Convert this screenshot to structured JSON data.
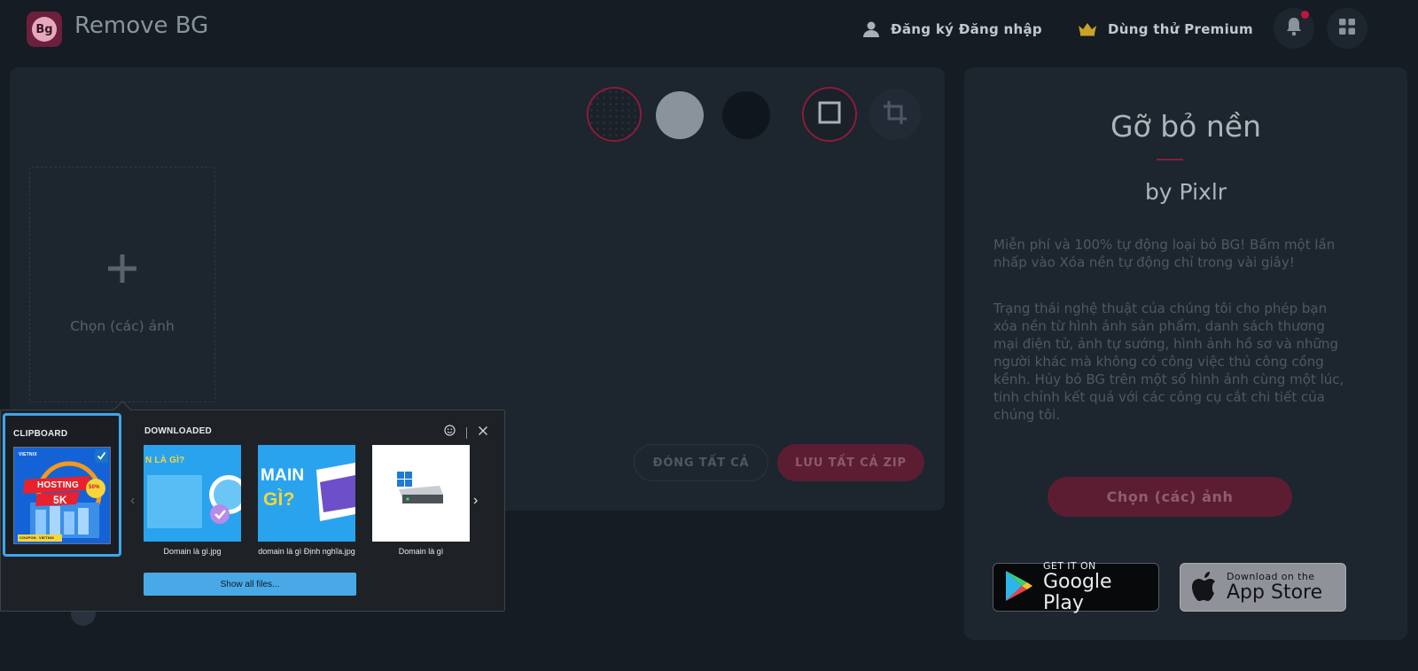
{
  "header": {
    "logo_text": "Bg",
    "app_title": "Remove BG",
    "auth_label": "Đăng ký Đăng nhập",
    "premium_label": "Dùng thử Premium"
  },
  "editor": {
    "dropzone_label": "Chọn (các) ảnh",
    "close_all_label": "ĐÓNG TẤT CẢ",
    "save_all_label": "LƯU TẤT CẢ ZIP"
  },
  "side": {
    "title": "Gỡ bỏ nền",
    "byline": "by Pixlr",
    "para1": "Miễn phí và 100% tự động loại bỏ BG! Bấm một lần nhấp vào Xóa nền tự động chỉ trong vài giây!",
    "para2": "Trạng thái nghệ thuật của chúng tôi cho phép bạn xóa nền từ hình ảnh sản phẩm, danh sách thương mại điện tử, ảnh tự sướng, hình ảnh hồ sơ và những người khác mà không có công việc thủ công cồng kềnh. Hủy bỏ BG trên một số hình ảnh cùng một lúc, tinh chỉnh kết quả với các công cụ cắt chi tiết của chúng tôi.",
    "cta_label": "Chọn (các) ảnh",
    "google_play": {
      "small": "GET IT ON",
      "big": "Google Play"
    },
    "app_store": {
      "small": "Download on the",
      "big": "App Store"
    }
  },
  "popup": {
    "clipboard_label": "CLIPBOARD",
    "downloaded_label": "DOWNLOADED",
    "clip_thumb": {
      "brand": "VIETNIX",
      "line1": "HOSTING",
      "line2": "5K",
      "badge": "50%",
      "footer1": "COUPON",
      "footer2": "VIETNIX"
    },
    "files": [
      {
        "caption": "Domain là gì.jpg",
        "headline": "N LÀ GÌ?"
      },
      {
        "caption": "domain là gì Định nghĩa.jpg",
        "headline": "MAIN",
        "headline2": "GÌ?"
      },
      {
        "caption": "Domain là gì"
      }
    ],
    "show_all_label": "Show all files..."
  },
  "colors": {
    "accent": "#8a1c3a",
    "background": "#151c24",
    "panel": "#1d252e",
    "popup_accent": "#3ea6ea"
  }
}
